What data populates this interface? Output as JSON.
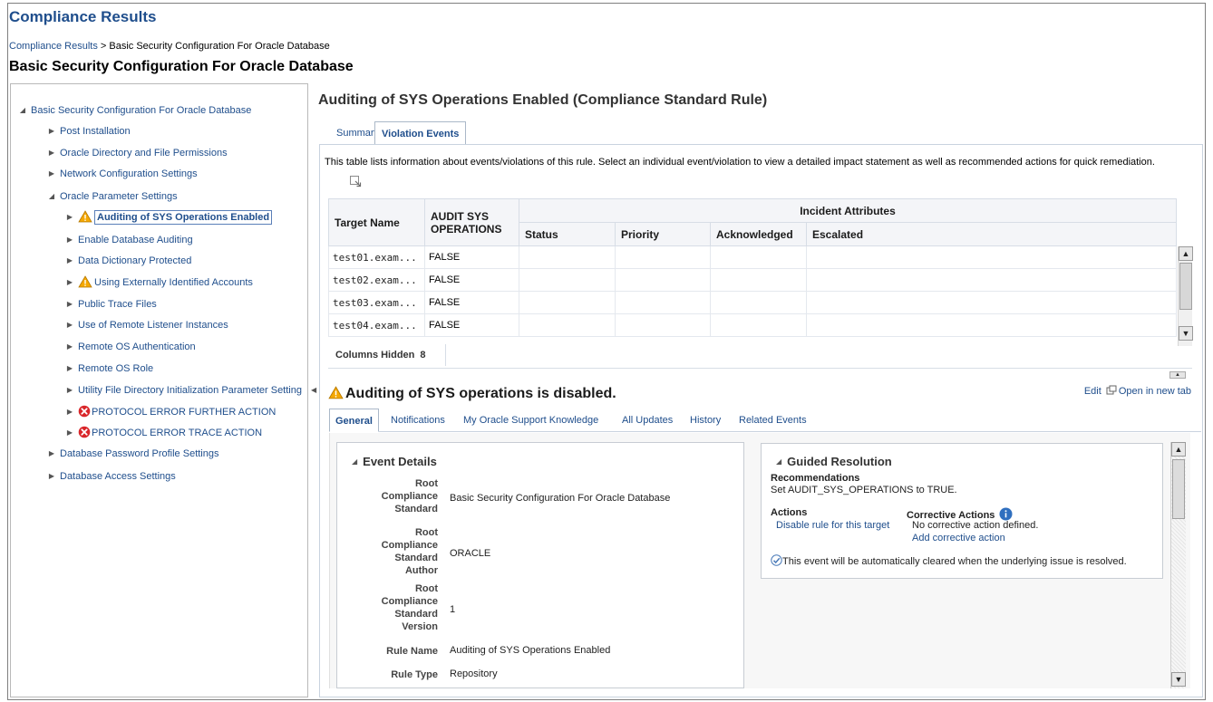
{
  "header": {
    "app_title": "Compliance Results",
    "breadcrumb": {
      "link": "Compliance Results",
      "separator": ">",
      "current": "Basic Security Configuration For Oracle Database"
    },
    "page_title": "Basic Security Configuration For Oracle Database"
  },
  "tree": {
    "root": "Basic Security Configuration For Oracle Database",
    "items": [
      {
        "label": "Post Installation"
      },
      {
        "label": "Oracle Directory and File Permissions"
      },
      {
        "label": "Network Configuration Settings"
      },
      {
        "label": "Oracle Parameter Settings"
      },
      {
        "label": "Auditing of SYS Operations Enabled"
      },
      {
        "label": "Enable Database Auditing"
      },
      {
        "label": "Data Dictionary Protected"
      },
      {
        "label": "Using Externally Identified Accounts"
      },
      {
        "label": "Public Trace Files"
      },
      {
        "label": "Use of Remote Listener Instances"
      },
      {
        "label": "Remote OS Authentication"
      },
      {
        "label": "Remote OS Role"
      },
      {
        "label": "Utility File Directory Initialization Parameter Setting"
      },
      {
        "label": "PROTOCOL ERROR FURTHER ACTION"
      },
      {
        "label": "PROTOCOL ERROR TRACE ACTION"
      },
      {
        "label": "Database Password Profile Settings"
      },
      {
        "label": "Database Access Settings"
      }
    ]
  },
  "rule": {
    "title": "Auditing of SYS Operations Enabled (Compliance Standard Rule)",
    "tabs": [
      "Summary",
      "Violation Events"
    ],
    "active_tab": "Violation Events"
  },
  "violations": {
    "intro": "This table lists information about events/violations of this rule. Select an individual event/violation to view a detailed impact statement as well as recommended actions for quick remediation.",
    "headers": {
      "target_name": "Target Name",
      "audit_sys": "AUDIT SYS OPERATIONS",
      "incident_attributes": "Incident Attributes",
      "status": "Status",
      "priority": "Priority",
      "acknowledged": "Acknowledged",
      "escalated": "Escalated"
    },
    "rows": [
      {
        "target": "test01.exam...",
        "audit": "FALSE",
        "status": "",
        "priority": "",
        "acknowledged": "",
        "escalated": ""
      },
      {
        "target": "test02.exam...",
        "audit": "FALSE",
        "status": "",
        "priority": "",
        "acknowledged": "",
        "escalated": ""
      },
      {
        "target": "test03.exam...",
        "audit": "FALSE",
        "status": "",
        "priority": "",
        "acknowledged": "",
        "escalated": ""
      },
      {
        "target": "test04.exam...",
        "audit": "FALSE",
        "status": "",
        "priority": "",
        "acknowledged": "",
        "escalated": ""
      }
    ],
    "columns_hidden_label": "Columns Hidden",
    "columns_hidden_count": "8"
  },
  "event": {
    "title": "Auditing of SYS operations is disabled.",
    "edit_label": "Edit",
    "open_new_tab_label": "Open in new tab",
    "tabs": [
      "General",
      "Notifications",
      "My Oracle Support Knowledge",
      "All Updates",
      "History",
      "Related Events"
    ],
    "active_tab": "General",
    "details": {
      "title": "Event Details",
      "fields": [
        {
          "label": "Root Compliance Standard",
          "value": "Basic Security Configuration For Oracle Database"
        },
        {
          "label": "Root Compliance Standard Author",
          "value": "ORACLE"
        },
        {
          "label": "Root Compliance Standard Version",
          "value": "1"
        },
        {
          "label": "Rule Name",
          "value": "Auditing of SYS Operations Enabled"
        },
        {
          "label": "Rule Type",
          "value": "Repository"
        }
      ]
    },
    "guided_resolution": {
      "title": "Guided Resolution",
      "recommendations_label": "Recommendations",
      "recommendation": "Set AUDIT_SYS_OPERATIONS to TRUE.",
      "actions_label": "Actions",
      "action_link": "Disable rule for this target",
      "corrective_label": "Corrective Actions",
      "corrective_text": "No corrective action defined.",
      "corrective_link": "Add corrective action",
      "auto_clear_text": "This event will be automatically cleared when the underlying issue is resolved."
    }
  },
  "colors": {
    "link": "#1f4e8c",
    "warning": "#f5a800",
    "error": "#d9262a",
    "info": "#2f6fbf"
  }
}
